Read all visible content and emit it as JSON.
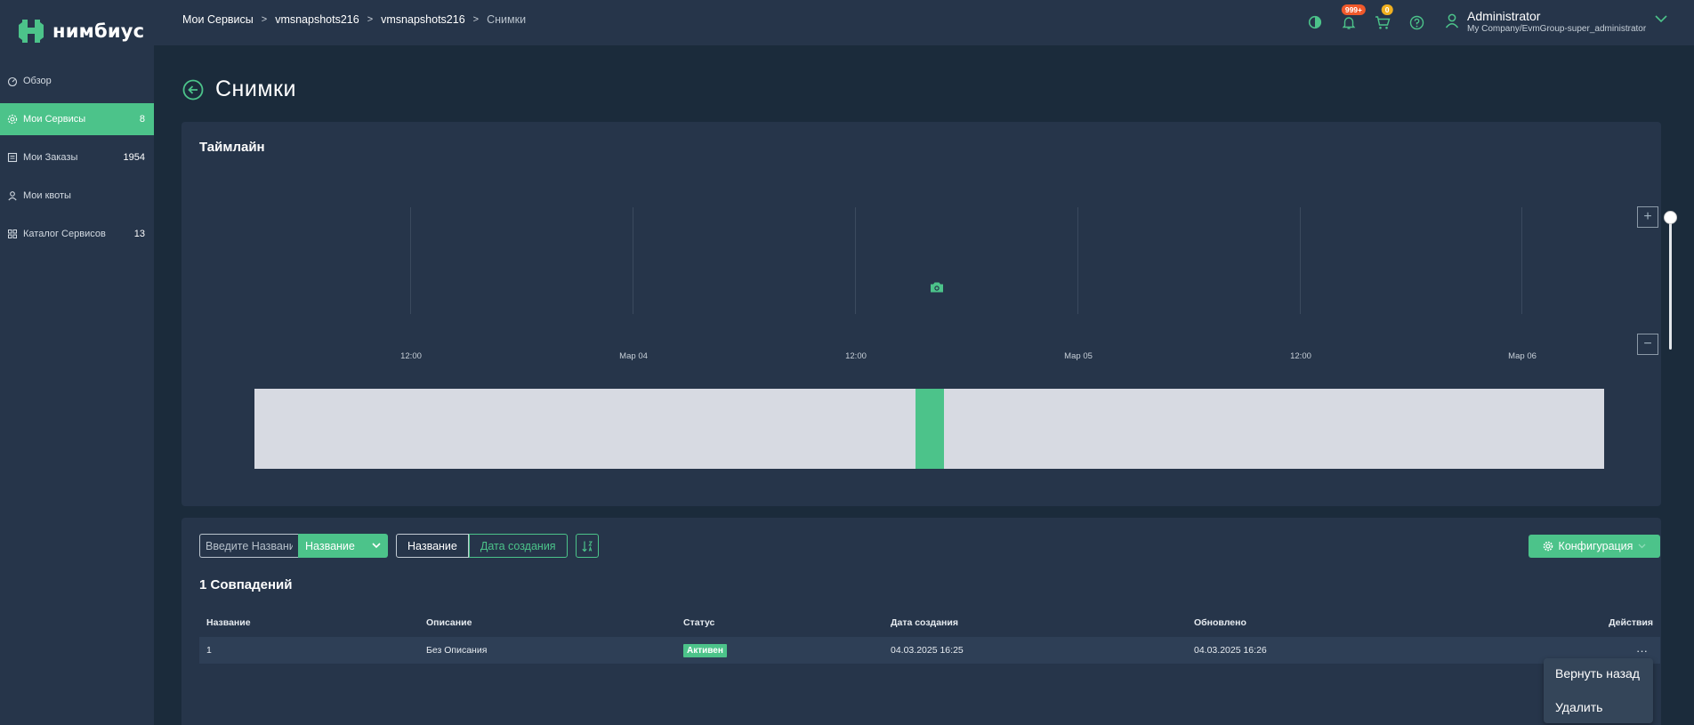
{
  "app": {
    "name": "нимбиус"
  },
  "sidebar": {
    "items": [
      {
        "label": "Обзор",
        "count": "",
        "icon": "dashboard-icon"
      },
      {
        "label": "Мои Сервисы",
        "count": "8",
        "icon": "gear-icon",
        "active": true
      },
      {
        "label": "Мои Заказы",
        "count": "1954",
        "icon": "list-icon"
      },
      {
        "label": "Мои квоты",
        "count": "",
        "icon": "user-icon"
      },
      {
        "label": "Каталог Сервисов",
        "count": "13",
        "icon": "grid-icon"
      }
    ]
  },
  "topbar": {
    "breadcrumb": [
      "Мои Сервисы",
      "vmsnapshots216",
      "vmsnapshots216",
      "Снимки"
    ],
    "notifications_badge": "999+",
    "cart_badge": "0",
    "user": {
      "name": "Administrator",
      "org": "My Company/EvmGroup-super_administrator"
    }
  },
  "page": {
    "title": "Снимки"
  },
  "timeline": {
    "title": "Таймлайн",
    "tick_labels": [
      "12:00",
      "Мар 04",
      "12:00",
      "Мар 05",
      "12:00",
      "Мар 06"
    ],
    "zoom_in_label": "+",
    "zoom_out_label": "−"
  },
  "toolbar": {
    "search_placeholder": "Введите Название",
    "filter_select_value": "Название",
    "sort_name_label": "Название",
    "sort_date_label": "Дата создания",
    "config_label": "Конфигурация"
  },
  "results": {
    "count_label": "1 Совпадений"
  },
  "table": {
    "headers": [
      "Название",
      "Описание",
      "Статус",
      "Дата создания",
      "Обновлено",
      "Действия"
    ],
    "rows": [
      {
        "name": "1",
        "description": "Без Описания",
        "status": "Активен",
        "created": "04.03.2025 16:25",
        "updated": "04.03.2025 16:26",
        "actions": "···"
      }
    ]
  },
  "row_menu": {
    "items": [
      "Вернуть назад",
      "Удалить"
    ]
  },
  "colors": {
    "accent": "#4cc38a",
    "sidebar_bg": "#26354a",
    "page_bg": "#1b2b3b",
    "badge_red": "#f0592b",
    "badge_orange": "#f0b020"
  }
}
